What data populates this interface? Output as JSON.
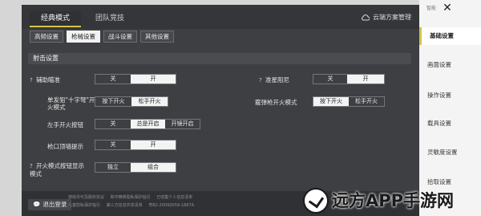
{
  "top_tabs": {
    "classic": "经典模式",
    "team": "团队竞技"
  },
  "cloud": {
    "label": "云端方案管理"
  },
  "sub_tabs": [
    "高频设置",
    "枪械设置",
    "战斗设置",
    "其他设置"
  ],
  "section": {
    "title": "射击设置"
  },
  "rows": {
    "assist_aim": {
      "label": "辅助瞄准",
      "off": "关",
      "on": "开"
    },
    "scope_resist": {
      "label": "准星阻尼",
      "off": "关",
      "on": "开"
    },
    "single_fire": {
      "label": "单发狙\"十字弩\"开火模式",
      "press": "按下开火",
      "release": "松手开火"
    },
    "shotgun_fire": {
      "label": "霰弹枪开火模式",
      "press": "按下开火",
      "release": "松手开火"
    },
    "left_fire": {
      "label": "左手开火按钮",
      "off": "关",
      "always": "总是开启",
      "scope": "开镜开启"
    },
    "muzzle_hint": {
      "label": "枪口顶墙提示",
      "off": "关",
      "on": "开"
    },
    "fire_mode_btn": {
      "label": "开火模式按钮显示模式",
      "separate": "独立",
      "combined": "组合"
    }
  },
  "footer": {
    "logout": "退出登录",
    "links": [
      "游戏许可及服务协议",
      "和平精英隐私保护指引",
      "已收集个人信息清单",
      "儿童隐私保护指引",
      "第三方信息共享清单",
      "粤B2-20090059-1867A"
    ]
  },
  "sidebar": {
    "items": [
      "基础设置",
      "画面设置",
      "操作设置",
      "载具设置",
      "灵敏度设置",
      "拾取设置"
    ],
    "active": "基础设置",
    "mini_label": "智能"
  },
  "watermark": {
    "text": "远方APP手游网"
  },
  "colors": {
    "accent": "#d8c24a",
    "panel": "#3d3f42",
    "sidebar": "#f4f4f4"
  }
}
